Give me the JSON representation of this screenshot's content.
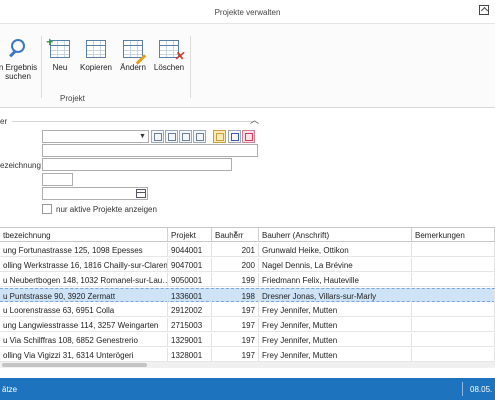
{
  "window": {
    "title": "Projekte verwalten"
  },
  "ribbon": {
    "search_label_1": "n Ergebnis",
    "search_label_2": "suchen",
    "new_label": "Neu",
    "copy_label": "Kopieren",
    "edit_label": "Ändern",
    "delete_label": "Löschen",
    "group_label": "Projekt"
  },
  "filter": {
    "title": "er",
    "label_designation": "ezeichnung",
    "checkbox_label": "nur aktive Projekte anzeigen",
    "checkbox_checked": false
  },
  "table": {
    "columns": [
      "tbezeichnung",
      "Projekt",
      "Bauherr",
      "Bauherr (Anschrift)",
      "Bemerkungen"
    ],
    "rows": [
      {
        "name": "ung Fortunastrasse 125, 1098 Epesses",
        "project": "9044001",
        "builder": "201",
        "address": "Grunwald Heike, Ottikon",
        "notes": "",
        "selected": false
      },
      {
        "name": "olling Werkstrasse 16, 1816 Chailly-sur-Clarens",
        "project": "9047001",
        "builder": "200",
        "address": "Nagel Dennis, La Brévine",
        "notes": "",
        "selected": false
      },
      {
        "name": "u Neubertbogen 148, 1032 Romanel-sur-Lau…",
        "project": "9050001",
        "builder": "199",
        "address": "Friedmann Felix, Hauteville",
        "notes": "",
        "selected": false
      },
      {
        "name": "u Puntstrasse 90, 3920 Zermatt",
        "project": "1336001",
        "builder": "198",
        "address": "Dresner Jonas, Villars-sur-Marly",
        "notes": "",
        "selected": true
      },
      {
        "name": "u Loorenstrasse 63, 6951 Colla",
        "project": "2912002",
        "builder": "197",
        "address": "Frey Jennifer, Mutten",
        "notes": "",
        "selected": false
      },
      {
        "name": "ung Langwiesstrasse 114, 3257 Weingarten",
        "project": "2715003",
        "builder": "197",
        "address": "Frey Jennifer, Mutten",
        "notes": "",
        "selected": false
      },
      {
        "name": "u Via Schilffras 108, 6852 Genestrerio",
        "project": "1329001",
        "builder": "197",
        "address": "Frey Jennifer, Mutten",
        "notes": "",
        "selected": false
      },
      {
        "name": "olling Via Vigizzi 31, 6314 Unterögeri",
        "project": "1328001",
        "builder": "197",
        "address": "Frey Jennifer, Mutten",
        "notes": "",
        "selected": false
      }
    ]
  },
  "status": {
    "left": "ätze",
    "right": "08.05."
  },
  "colors": {
    "accent": "#1e73be",
    "selection": "#cfe3f7"
  }
}
